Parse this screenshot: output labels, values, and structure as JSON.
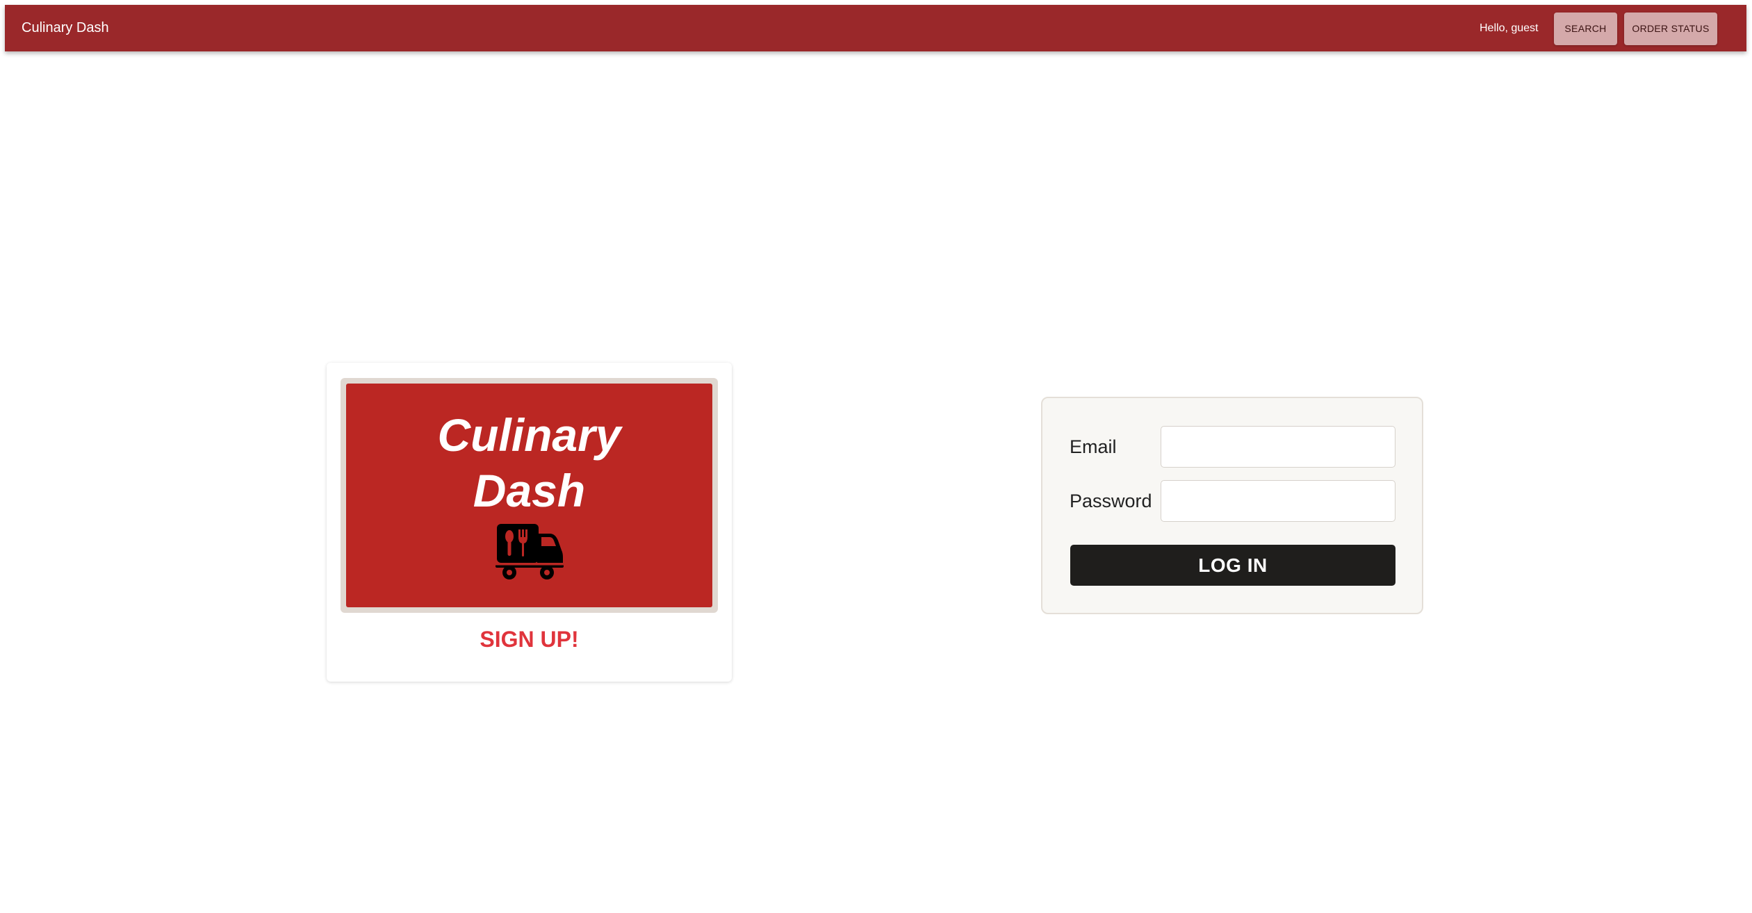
{
  "appbar": {
    "title": "Culinary Dash",
    "greeting": "Hello, guest",
    "buttons": {
      "search": "SEARCH",
      "order_status": "ORDER STATUS"
    },
    "color": "#9a282a"
  },
  "signup": {
    "logo_line1": "Culinary",
    "logo_line2": "Dash",
    "logo_icon": "food-truck-icon",
    "logo_color": "#bb2723",
    "link_label": "SIGN UP!",
    "link_color": "#e0343c"
  },
  "login": {
    "email_label": "Email",
    "email_value": "",
    "password_label": "Password",
    "password_value": "",
    "submit_label": "LOG IN"
  }
}
